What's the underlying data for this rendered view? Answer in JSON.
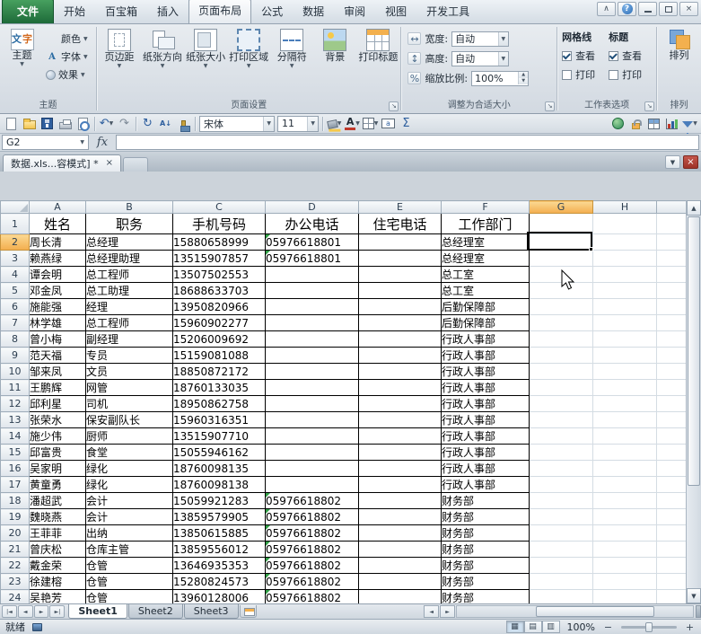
{
  "colors": {
    "file_tab_green": "#1d6a39",
    "selection_header_orange": "#f3ae4e",
    "warning_triangle_green": "#2f9e44",
    "close_button_red": "#9e3227"
  },
  "glyphs": {
    "dropdown": "▼",
    "up": "▲",
    "down": "▼",
    "left": "◄",
    "right": "►",
    "first": "|◄",
    "last": "►|",
    "undo": "↶",
    "redo": "↷",
    "refresh": "↻",
    "sum": "Σ",
    "launcher": "↘",
    "sort": "A↓",
    "normal_view": "▦",
    "layout_view": "▤",
    "break_view": "▥"
  },
  "window": {
    "collapse": "∧",
    "help": "?",
    "close": "×"
  },
  "ribbon_tabs": [
    {
      "label": "文件",
      "type": "file"
    },
    {
      "label": "开始"
    },
    {
      "label": "百宝箱"
    },
    {
      "label": "插入"
    },
    {
      "label": "页面布局",
      "active": true
    },
    {
      "label": "公式"
    },
    {
      "label": "数据"
    },
    {
      "label": "审阅"
    },
    {
      "label": "视图"
    },
    {
      "label": "开发工具"
    }
  ],
  "ribbon": {
    "themes": {
      "group_label": "主题",
      "main_button": "主题",
      "main_icon_text_1": "文",
      "main_icon_text_2": "字",
      "color_button": "颜色",
      "font_button": "字体",
      "font_icon_letter": "A",
      "effect_button": "效果"
    },
    "page_setup": {
      "group_label": "页面设置",
      "buttons": [
        {
          "label": "页边距"
        },
        {
          "label": "纸张方向"
        },
        {
          "label": "纸张大小"
        },
        {
          "label": "打印区域"
        },
        {
          "label": "分隔符"
        },
        {
          "label": "背景"
        },
        {
          "label": "打印标题"
        }
      ]
    },
    "scale_to_fit": {
      "group_label": "调整为合适大小",
      "rows": [
        {
          "label": "宽度:",
          "value": "自动",
          "icon": "↔"
        },
        {
          "label": "高度:",
          "value": "自动",
          "icon": "↕"
        },
        {
          "label": "缩放比例:",
          "value": "100%",
          "icon": "%"
        }
      ]
    },
    "sheet_options": {
      "group_label": "工作表选项",
      "columns": [
        {
          "title": "网格线",
          "view": "查看",
          "print": "打印"
        },
        {
          "title": "标题",
          "view": "查看",
          "print": "打印"
        }
      ]
    },
    "arrange": {
      "group_label": "排列",
      "main_button": "排列"
    }
  },
  "toolbar": {
    "font_name": "宋体",
    "font_size": "11"
  },
  "formula_bar": {
    "name_box": "G2",
    "fx_label": "fx",
    "value": ""
  },
  "doc_tabs": {
    "active_title": "数据.xls...容模式] *",
    "close": "×"
  },
  "grid": {
    "columns": [
      "A",
      "B",
      "C",
      "D",
      "E",
      "F",
      "G",
      "H"
    ],
    "selected_column": "G",
    "selected_row": 2,
    "selected_cell": "G2",
    "header_row": [
      "姓名",
      "职务",
      "手机号码",
      "办公电话",
      "住宅电话",
      "工作部门"
    ],
    "rows": [
      [
        "周长清",
        "总经理",
        "15880658999",
        "05976618801",
        "",
        "总经理室"
      ],
      [
        "赖燕绿",
        "总经理助理",
        "13515907857",
        "05976618801",
        "",
        "总经理室"
      ],
      [
        "谭会明",
        "总工程师",
        "13507502553",
        "",
        "",
        "总工室"
      ],
      [
        "邓金凤",
        "总工助理",
        "18688633703",
        "",
        "",
        "总工室"
      ],
      [
        "施能强",
        "经理",
        "13950820966",
        "",
        "",
        "后勤保障部"
      ],
      [
        "林学雄",
        "总工程师",
        "15960902277",
        "",
        "",
        "后勤保障部"
      ],
      [
        "曾小梅",
        "副经理",
        "15206009692",
        "",
        "",
        "行政人事部"
      ],
      [
        "范天福",
        "专员",
        "15159081088",
        "",
        "",
        "行政人事部"
      ],
      [
        "邹来凤",
        "文员",
        "18850872172",
        "",
        "",
        "行政人事部"
      ],
      [
        "王鹏辉",
        "网管",
        "18760133035",
        "",
        "",
        "行政人事部"
      ],
      [
        "邱利星",
        "司机",
        "18950862758",
        "",
        "",
        "行政人事部"
      ],
      [
        "张荣水",
        "保安副队长",
        "15960316351",
        "",
        "",
        "行政人事部"
      ],
      [
        "施少伟",
        "厨师",
        "13515907710",
        "",
        "",
        "行政人事部"
      ],
      [
        "邱富贵",
        "食堂",
        "15055946162",
        "",
        "",
        "行政人事部"
      ],
      [
        "吴家明",
        "绿化",
        "18760098135",
        "",
        "",
        "行政人事部"
      ],
      [
        "黄童勇",
        "绿化",
        "18760098138",
        "",
        "",
        "行政人事部"
      ],
      [
        "潘超武",
        "会计",
        "15059921283",
        "05976618802",
        "",
        "财务部"
      ],
      [
        "魏晓燕",
        "会计",
        "13859579905",
        "05976618802",
        "",
        "财务部"
      ],
      [
        "王菲菲",
        "出纳",
        "13850615885",
        "05976618802",
        "",
        "财务部"
      ],
      [
        "曾庆松",
        "仓库主管",
        "13859556012",
        "05976618802",
        "",
        "财务部"
      ],
      [
        "戴金荣",
        "仓管",
        "13646935353",
        "05976618802",
        "",
        "财务部"
      ],
      [
        "徐建榕",
        "仓管",
        "15280824573",
        "05976618802",
        "",
        "财务部"
      ],
      [
        "吴艳芳",
        "仓管",
        "13960128006",
        "05976618802",
        "",
        "财务部"
      ]
    ]
  },
  "sheet_tabs": {
    "tabs": [
      "Sheet1",
      "Sheet2",
      "Sheet3"
    ],
    "active": "Sheet1"
  },
  "status_bar": {
    "ready_label": "就绪",
    "zoom_value": "100%",
    "zoom_out": "−",
    "zoom_in": "+"
  }
}
